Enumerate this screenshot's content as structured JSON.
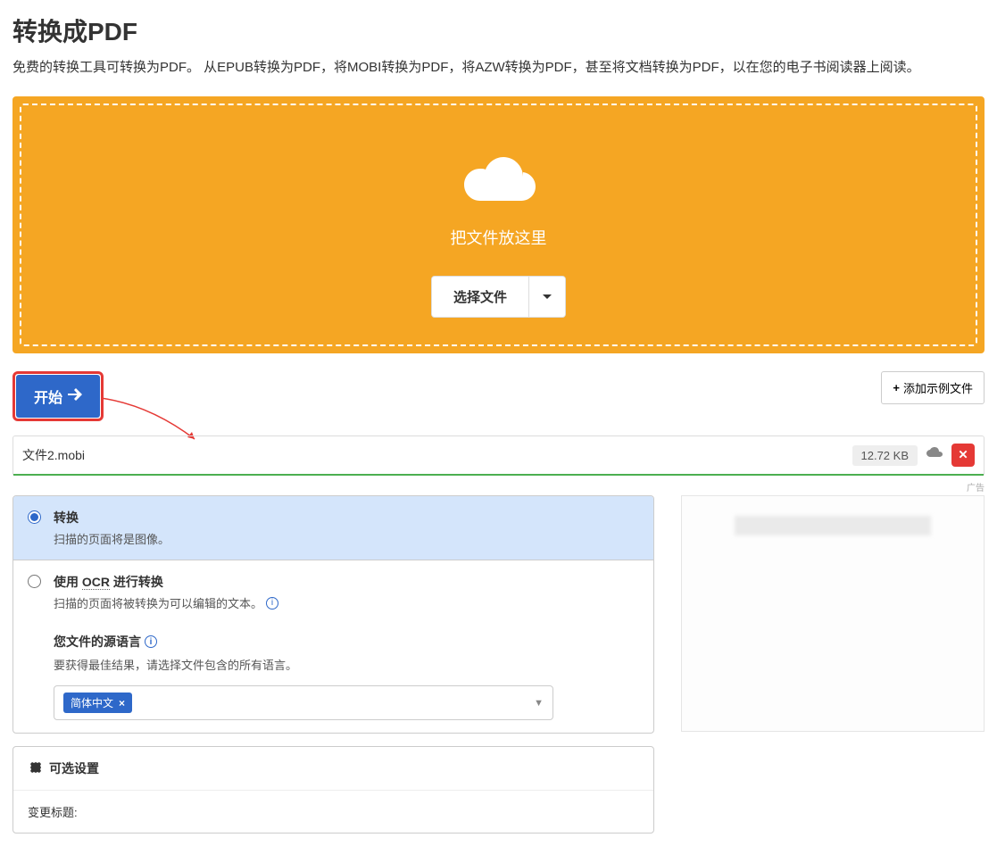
{
  "header": {
    "title": "转换成PDF",
    "description": "免费的转换工具可转换为PDF。 从EPUB转换为PDF，将MOBI转换为PDF，将AZW转换为PDF，甚至将文档转换为PDF，以在您的电子书阅读器上阅读。"
  },
  "dropzone": {
    "text": "把文件放这里",
    "select_button": "选择文件"
  },
  "actions": {
    "start_label": "开始",
    "add_example_label": "添加示例文件"
  },
  "file": {
    "name": "文件2.mobi",
    "size": "12.72 KB"
  },
  "ad_label": "广告",
  "options": {
    "convert": {
      "title": "转换",
      "desc": "扫描的页面将是图像。"
    },
    "ocr": {
      "title_prefix": "使用 ",
      "title_ocr": "OCR",
      "title_suffix": " 进行转换",
      "desc": "扫描的页面将被转换为可以编辑的文本。",
      "source_lang_label": "您文件的源语言",
      "source_lang_desc": "要获得最佳结果，请选择文件包含的所有语言。",
      "selected_lang": "简体中文"
    }
  },
  "settings": {
    "header": "可选设置",
    "change_title_label": "变更标题:"
  }
}
